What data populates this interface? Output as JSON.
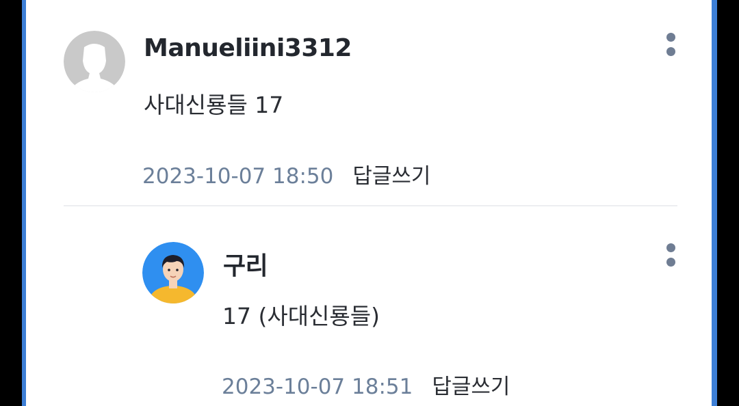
{
  "comments": [
    {
      "author": "Manueliini3312",
      "text": "사대신룡들 17",
      "timestamp": "2023-10-07 18:50",
      "reply_label": "답글쓰기",
      "avatar_icon": "default-user-silhouette-icon",
      "menu_icon": "more-vertical-icon"
    },
    {
      "author": "구리",
      "text": "17 (사대신룡들)",
      "timestamp": "2023-10-07 18:51",
      "reply_label": "답글쓰기",
      "avatar_icon": "cartoon-boy-avatar-icon",
      "menu_icon": "more-vertical-icon"
    }
  ],
  "colors": {
    "frame_border": "#3d7fd6",
    "timestamp": "#6b7f99",
    "menu_dots": "#6f7d93",
    "avatar_blue": "#2f8ff0",
    "avatar_shirt": "#f5b82e"
  }
}
